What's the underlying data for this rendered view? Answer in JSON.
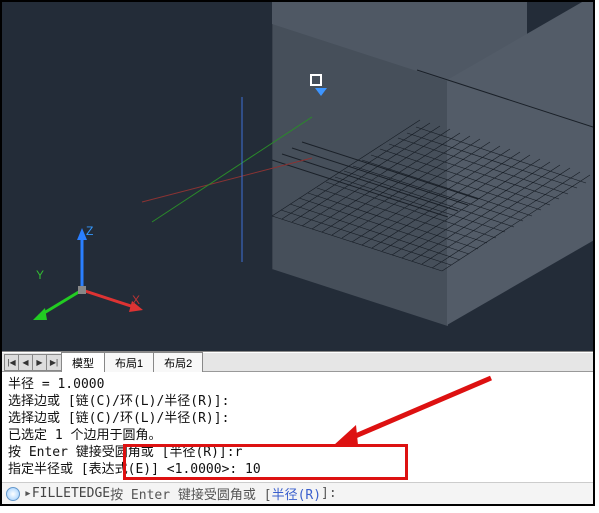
{
  "nav": {
    "first": "|◀",
    "prev": "◀",
    "next": "▶",
    "last": "▶|"
  },
  "tabs": {
    "model": "模型",
    "layout1": "布局1",
    "layout2": "布局2"
  },
  "ucs": {
    "x": "X",
    "y": "Y",
    "z": "Z"
  },
  "cmd": {
    "l1": "半径 = 1.0000",
    "l2": "选择边或 [链(C)/环(L)/半径(R)]:",
    "l3": "选择边或 [链(C)/环(L)/半径(R)]:",
    "l4": "已选定 1 个边用于圆角。",
    "l5": "按 Enter 键接受圆角或 [半径(R)]:r",
    "l6": "指定半径或 [表达式(E)] <1.0000>: 10"
  },
  "cmdbar": {
    "icon_name": "cmd-balloon-icon",
    "cmd_name": "FILLETEDGE",
    "prompt_pre": " 按 Enter 键接受圆角或 [",
    "opt": "半径(R)",
    "prompt_post": "]:"
  }
}
